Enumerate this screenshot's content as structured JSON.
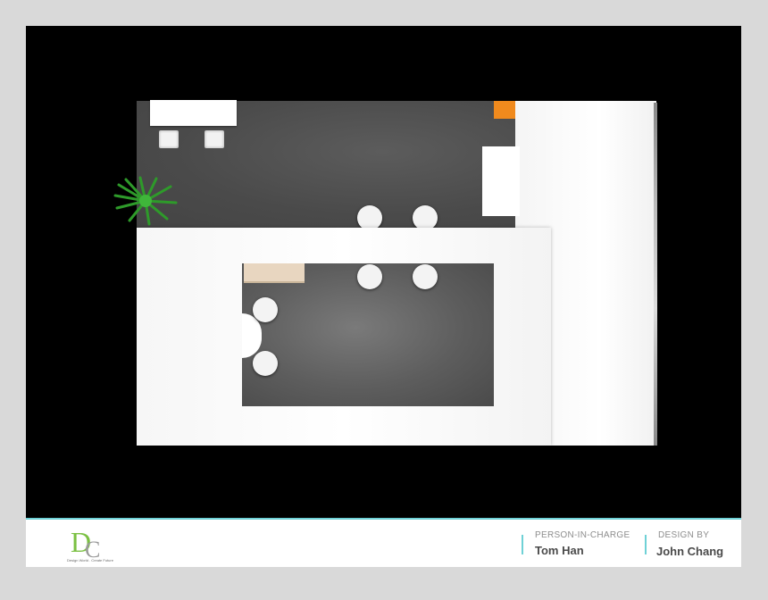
{
  "brand": {
    "logo_letters": "DC",
    "tagline": "Design World . Create Future",
    "colors": {
      "logo_green": "#7bc043",
      "accent_teal": "#6fd1d6"
    }
  },
  "footer": {
    "person_label": "PERSON-IN-CHARGE",
    "person_name": "Tom Han",
    "design_label": "DESIGN BY",
    "design_name": "John Chang"
  },
  "scene": {
    "description_icons": [
      "plant-icon",
      "chair-icon",
      "stool-icon"
    ],
    "colors": {
      "background": "#000000",
      "carpet": "#555555",
      "wall": "#ffffff",
      "accent_orange": "#f08a1d"
    }
  }
}
